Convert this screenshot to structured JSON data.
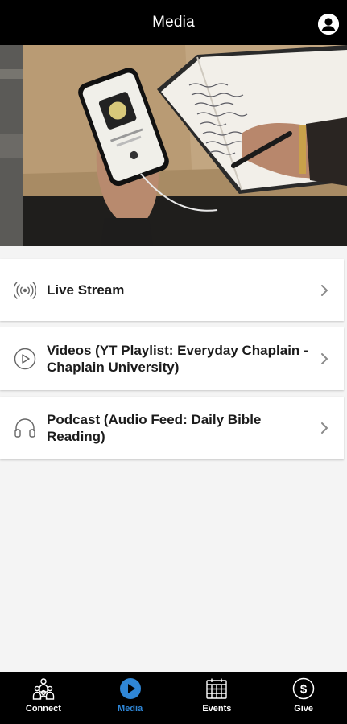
{
  "header": {
    "title": "Media",
    "profile_icon": "profile-icon"
  },
  "hero": {
    "image": "phone-and-notebook-photo"
  },
  "media_items": [
    {
      "label": "Live Stream",
      "icon": "broadcast-icon"
    },
    {
      "label": "Videos (YT Playlist: Everyday Chaplain - Chaplain University)",
      "icon": "play-circle-icon"
    },
    {
      "label": "Podcast (Audio Feed: Daily Bible Reading)",
      "icon": "headphones-icon"
    }
  ],
  "tabs": [
    {
      "label": "Connect",
      "icon": "people-icon",
      "active": false
    },
    {
      "label": "Media",
      "icon": "play-icon",
      "active": true
    },
    {
      "label": "Events",
      "icon": "calendar-icon",
      "active": false
    },
    {
      "label": "Give",
      "icon": "dollar-icon",
      "active": false
    }
  ],
  "colors": {
    "accent": "#2f86d6",
    "header_bg": "#000000",
    "background": "#f4f4f4"
  }
}
